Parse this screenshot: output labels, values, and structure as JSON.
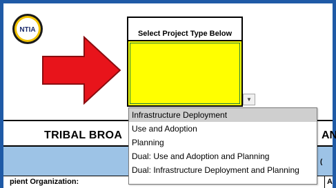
{
  "logo": {
    "text": "NTIA"
  },
  "select": {
    "header": "Select Project Type Below",
    "value": "",
    "color": "#FFFF00"
  },
  "dropdown": {
    "options": [
      "Infrastructure Deployment",
      "Use and Adoption",
      "Planning",
      "Dual: Use and Adoption and Planning",
      "Dual: Infrastructure Deployment and Planning"
    ],
    "highlighted_index": 0,
    "button_icon": "chevron-down-icon"
  },
  "sheet": {
    "title_visible": "TRIBAL BROA",
    "title_right_fragment": "AN",
    "band_right_fragment": "(",
    "recipient_label": "pient Organization:",
    "recipient_right_fragment": "A"
  },
  "colors": {
    "frame": "#1F5AA6",
    "band": "#9DC3E6",
    "arrow": "#E8141B"
  }
}
